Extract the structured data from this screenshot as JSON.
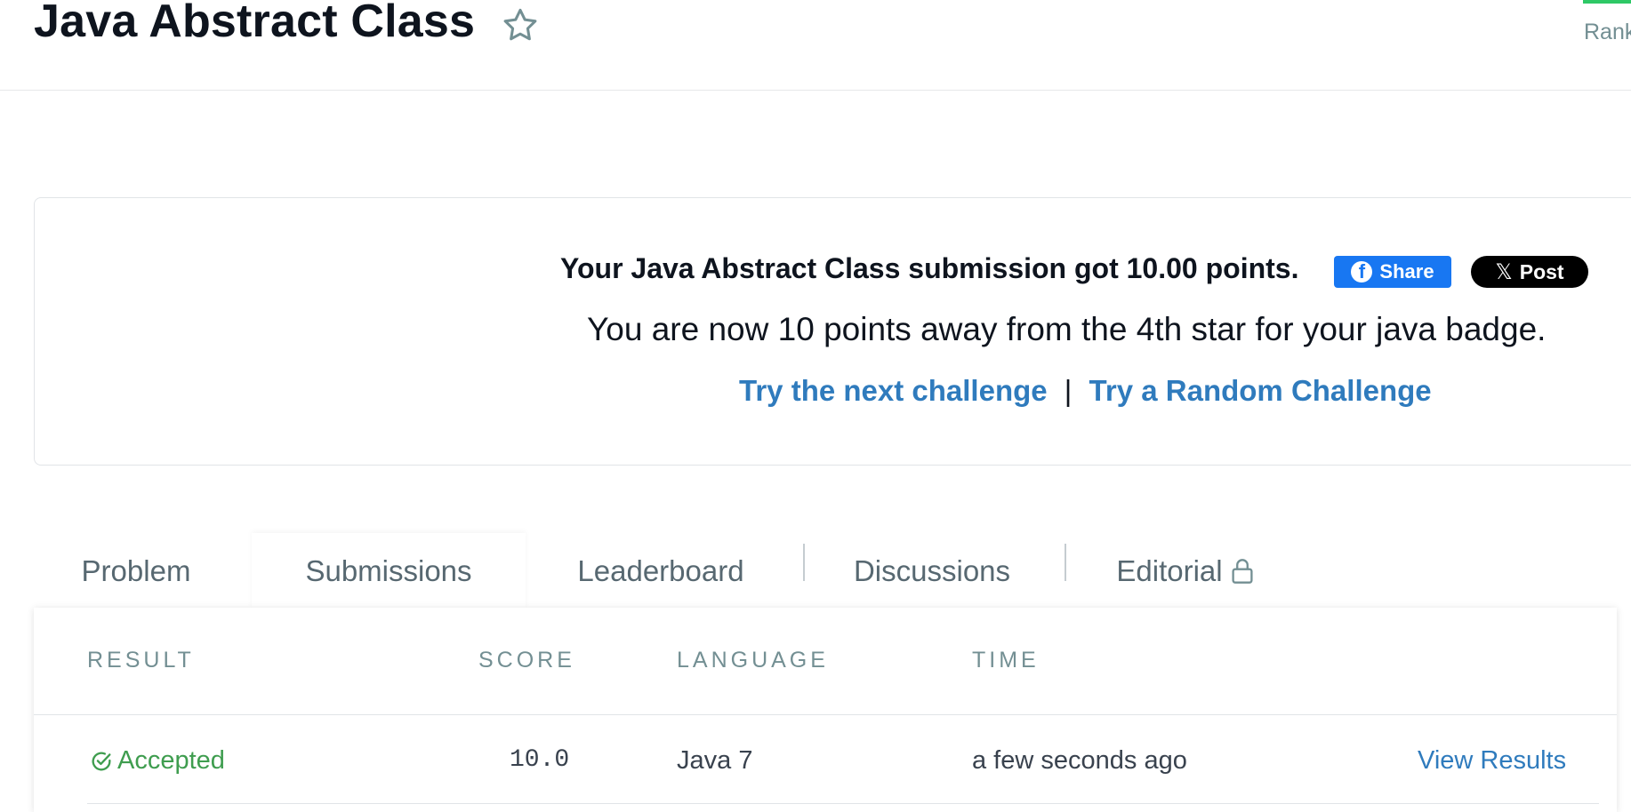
{
  "header": {
    "title": "Java Abstract Class",
    "rank_label": "Rank"
  },
  "congrats": {
    "points_line": "Your Java Abstract Class submission got 10.00 points.",
    "share_label": "Share",
    "post_label": "Post",
    "badge_line": "You are now 10 points away from the 4th star for your java badge.",
    "next_challenge": "Try the next challenge",
    "separator": "|",
    "random_challenge": "Try a Random Challenge"
  },
  "tabs": [
    {
      "label": "Problem",
      "active": false
    },
    {
      "label": "Submissions",
      "active": true
    },
    {
      "label": "Leaderboard",
      "active": false
    },
    {
      "label": "Discussions",
      "active": false
    },
    {
      "label": "Editorial",
      "active": false,
      "locked": true
    }
  ],
  "table": {
    "columns": [
      "RESULT",
      "SCORE",
      "LANGUAGE",
      "TIME"
    ],
    "rows": [
      {
        "result": "Accepted",
        "score": "10.0",
        "language": "Java 7",
        "time": "a few seconds ago",
        "action": "View Results"
      }
    ]
  },
  "colors": {
    "accent_green": "#2ec866",
    "link_blue": "#2f7bbd",
    "accepted_green": "#3f9d4f",
    "facebook_blue": "#1877f2"
  },
  "icons": {
    "title_star": "star-outline-icon",
    "facebook": "facebook-icon",
    "x": "x-logo-icon",
    "lock": "lock-icon",
    "check": "check-circle-icon"
  }
}
